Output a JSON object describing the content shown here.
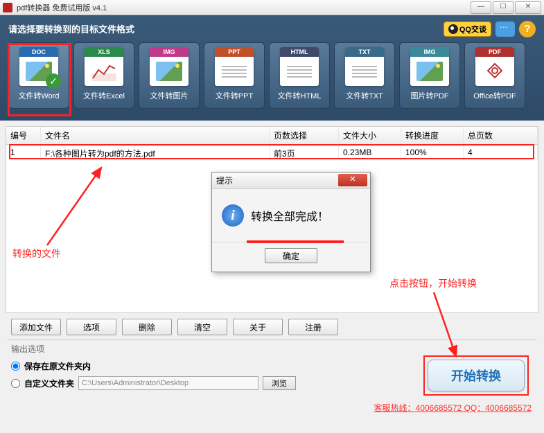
{
  "window": {
    "title": "pdf转换器 免费试用版 v4.1"
  },
  "toolbar": {
    "title": "请选择要转换到的目标文件格式",
    "qq_label": "QQ交谈",
    "help": "?",
    "formats": [
      {
        "tag": "DOC",
        "tag_color": "#2a6ab0",
        "label": "文件转Word",
        "kind": "pic"
      },
      {
        "tag": "XLS",
        "tag_color": "#2a8a4a",
        "label": "文件转Excel",
        "kind": "chart"
      },
      {
        "tag": "IMG",
        "tag_color": "#c03a8a",
        "label": "文件转图片",
        "kind": "pic"
      },
      {
        "tag": "PPT",
        "tag_color": "#c0502a",
        "label": "文件转PPT",
        "kind": "lines"
      },
      {
        "tag": "HTML",
        "tag_color": "#404a6a",
        "label": "文件转HTML",
        "kind": "lines"
      },
      {
        "tag": "TXT",
        "tag_color": "#3a6a8a",
        "label": "文件转TXT",
        "kind": "lines"
      },
      {
        "tag": "IMG",
        "tag_color": "#3a8a9a",
        "label": "图片转PDF",
        "kind": "pic"
      },
      {
        "tag": "PDF",
        "tag_color": "#b03030",
        "label": "Office转PDF",
        "kind": "pdf"
      }
    ]
  },
  "table": {
    "headers": {
      "num": "编号",
      "name": "文件名",
      "pages": "页数选择",
      "size": "文件大小",
      "prog": "转换进度",
      "total": "总页数"
    },
    "rows": [
      {
        "num": "1",
        "name": "F:\\各种图片转为pdf的方法.pdf",
        "pages": "前3页",
        "size": "0.23MB",
        "prog": "100%",
        "total": "4"
      }
    ]
  },
  "dialog": {
    "title": "提示",
    "message": "转换全部完成！",
    "ok": "确定"
  },
  "annotations": {
    "file": "转换的文件",
    "start": "点击按钮，开始转换"
  },
  "buttons": {
    "add": "添加文件",
    "options": "选项",
    "delete": "删除",
    "clear": "清空",
    "about": "关于",
    "register": "注册"
  },
  "output": {
    "title": "输出选项",
    "save_orig": "保存在原文件夹内",
    "custom": "自定义文件夹",
    "path": "C:\\Users\\Administrator\\Desktop",
    "browse": "浏览"
  },
  "start_btn": "开始转换",
  "hotline": "客服热线：4006685572 QQ：4006685572"
}
